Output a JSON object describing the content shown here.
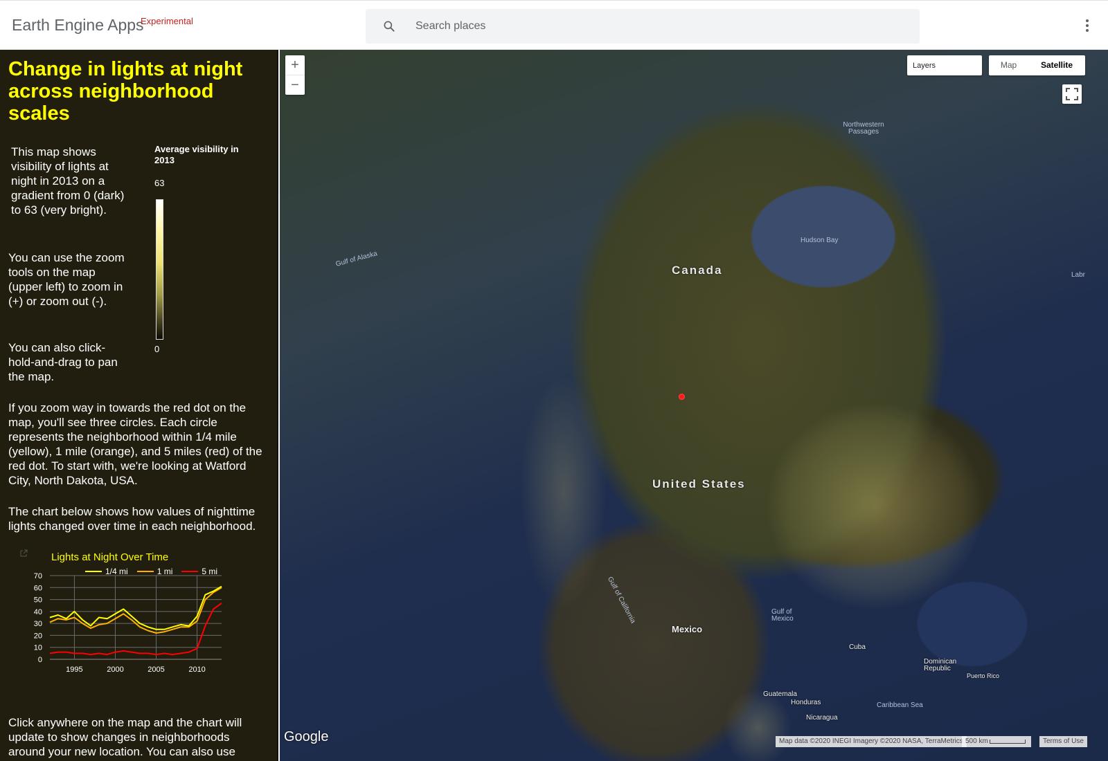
{
  "header": {
    "brand": "Earth Engine Apps",
    "brand_tag": "Experimental",
    "search_placeholder": "Search places",
    "icons": {
      "search": "search-icon",
      "menu": "more-vert-icon"
    }
  },
  "panel": {
    "title": "Change in lights at night across neighborhood scales",
    "intro": "This map shows visibility of lights at night in 2013 on a gradient from 0 (dark) to 63 (very bright).",
    "zoom_text": "You can use the zoom tools on the map (upper left) to zoom in (+) or zoom out (-).",
    "drag_text": "You can also click-hold-and-drag to pan the map.",
    "dot_text": "If you zoom way in towards the red dot on the map, you'll see three circles. Each circle represents the neighborhood within 1/4 mile (yellow), 1 mile (orange), and 5 miles (red) of the red dot. To start with, we're looking at Watford City, North Dakota, USA.",
    "chart_text": "The chart below shows how values of nighttime lights changed over time in each neighborhood.",
    "click_text": "Click anywhere on the map and the chart will update to show changes in neighborhoods around your new location. You can also use",
    "legend": {
      "title": "Average visibility in 2013",
      "max": "63",
      "min": "0"
    }
  },
  "chart_data": {
    "type": "line",
    "title": "Lights at Night Over Time",
    "xlabel": "",
    "ylabel": "",
    "xlim": [
      1992,
      2013
    ],
    "ylim": [
      0,
      70
    ],
    "yticks": [
      0,
      10,
      20,
      30,
      40,
      50,
      60,
      70
    ],
    "xticks": [
      1995,
      2000,
      2005,
      2010
    ],
    "legend_position": "top",
    "grid": true,
    "x": [
      1992,
      1993,
      1994,
      1995,
      1996,
      1997,
      1998,
      1999,
      2000,
      2001,
      2002,
      2003,
      2004,
      2005,
      2006,
      2007,
      2008,
      2009,
      2010,
      2011,
      2012,
      2013
    ],
    "series": [
      {
        "name": "1/4 mi",
        "color": "#ffff00",
        "values": [
          35,
          37,
          34,
          40,
          33,
          28,
          35,
          34,
          38,
          42,
          36,
          30,
          27,
          25,
          25,
          27,
          29,
          28,
          36,
          54,
          57,
          61
        ]
      },
      {
        "name": "1 mi",
        "color": "#ffb000",
        "values": [
          31,
          34,
          33,
          35,
          30,
          26,
          29,
          30,
          34,
          38,
          33,
          27,
          24,
          22,
          23,
          25,
          27,
          27,
          32,
          50,
          56,
          60
        ]
      },
      {
        "name": "5 mi",
        "color": "#ff0000",
        "values": [
          5,
          6,
          6,
          5,
          5,
          4,
          5,
          4,
          6,
          7,
          6,
          5,
          5,
          4,
          5,
          4,
          5,
          6,
          9,
          28,
          42,
          47
        ]
      }
    ]
  },
  "map": {
    "zoom_in": "+",
    "zoom_out": "−",
    "layers": "Layers",
    "map_type": "Map",
    "satellite": "Satellite",
    "labels": {
      "canada": "Canada",
      "us": "United States",
      "mexico": "Mexico",
      "hudson": "Hudson Bay",
      "alaska": "Gulf of Alaska",
      "nw_passages": "Northwestern Passages",
      "gulf_mexico": "Gulf of Mexico",
      "gulf_california": "Gulf of California",
      "cuba": "Cuba",
      "dominican": "Dominican Republic",
      "puerto_rico": "Puerto Rico",
      "guatemala": "Guatemala",
      "honduras": "Honduras",
      "nicaragua": "Nicaragua",
      "caribbean": "Caribbean Sea",
      "labrador": "Labr"
    },
    "google": "Google",
    "attribution": "Map data ©2020 INEGI Imagery ©2020 NASA, TerraMetrics",
    "scale": "500 km",
    "terms": "Terms of Use",
    "icons": {
      "fullscreen": "fullscreen-icon",
      "marker": "location-dot-icon",
      "popout": "open-in-new-icon"
    }
  }
}
